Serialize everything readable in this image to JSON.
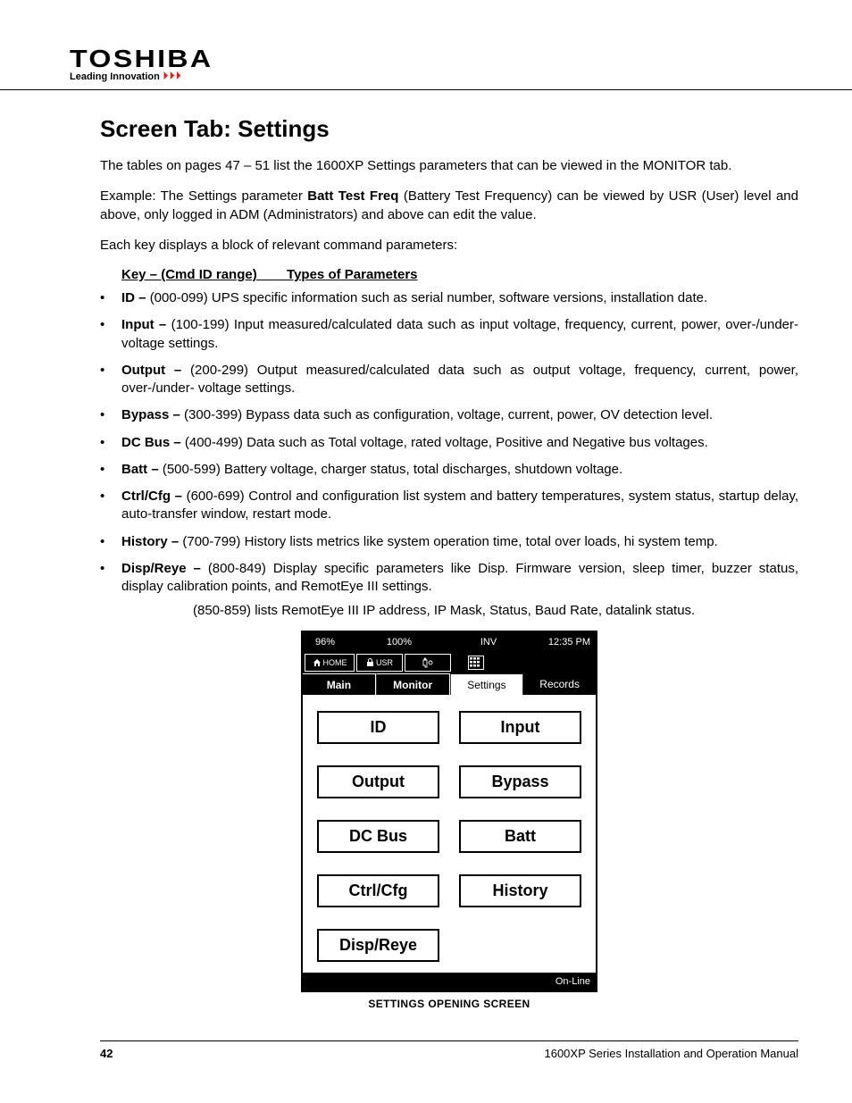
{
  "brand": {
    "name": "TOSHIBA",
    "tagline": "Leading Innovation"
  },
  "title": "Screen Tab: Settings",
  "intro": "The tables on pages 47 – 51 list the 1600XP Settings parameters that can be viewed in the MONITOR tab.",
  "example_pre": "Example:  The Settings parameter ",
  "example_bold": "Batt Test Freq",
  "example_post": " (Battery Test Frequency) can be viewed by USR (User) level and above, only logged in ADM (Administrators) and above can edit the value.",
  "each_key": "Each key displays a block of relevant command parameters:",
  "keyline": "Key – (Cmd ID range)        Types of Parameters",
  "bullets": [
    {
      "b": "ID – ",
      "t": "(000-099) UPS specific information such as serial number, software versions, installation date."
    },
    {
      "b": "Input – ",
      "t": "(100-199) Input measured/calculated data such as input voltage, frequency, current, power, over-/under- voltage settings."
    },
    {
      "b": "Output – ",
      "t": "(200-299) Output measured/calculated data such as output voltage, frequency, current, power, over-/under- voltage settings."
    },
    {
      "b": "Bypass – ",
      "t": "(300-399) Bypass data such as configuration, voltage, current, power, OV detection level."
    },
    {
      "b": "DC Bus – ",
      "t": "(400-499) Data such as Total voltage, rated voltage, Positive and Negative bus voltages."
    },
    {
      "b": "Batt – ",
      "t": "(500-599) Battery voltage, charger status, total discharges, shutdown voltage."
    },
    {
      "b": "Ctrl/Cfg – ",
      "t": "(600-699) Control and configuration list system and battery temperatures, system status, startup delay, auto-transfer window, restart mode."
    },
    {
      "b": "History – ",
      "t": "(700-799) History lists metrics like system operation time, total over loads, hi system temp."
    },
    {
      "b": "Disp/Reye – ",
      "t": "(800-849) Display specific parameters like Disp. Firmware version, sleep timer, buzzer status, display calibration points, and RemotEye III settings."
    }
  ],
  "sub_indent": "(850-859) lists RemotEye III IP address, IP Mask, Status, Baud Rate, datalink status.",
  "device": {
    "status": {
      "pct1": "96%",
      "pct2": "100%",
      "mode": "INV",
      "time": "12:35 PM"
    },
    "bar2": {
      "home": "HOME",
      "usr": "USR"
    },
    "tabs": {
      "main": "Main",
      "monitor": "Monitor",
      "settings": "Settings",
      "records": "Records"
    },
    "keys": [
      "ID",
      "Input",
      "Output",
      "Bypass",
      "DC Bus",
      "Batt",
      "Ctrl/Cfg",
      "History",
      "Disp/Reye"
    ],
    "footer": "On-Line",
    "caption": "SETTINGS OPENING SCREEN"
  },
  "pagefoot": {
    "num": "42",
    "manual": "1600XP Series Installation and Operation Manual"
  }
}
